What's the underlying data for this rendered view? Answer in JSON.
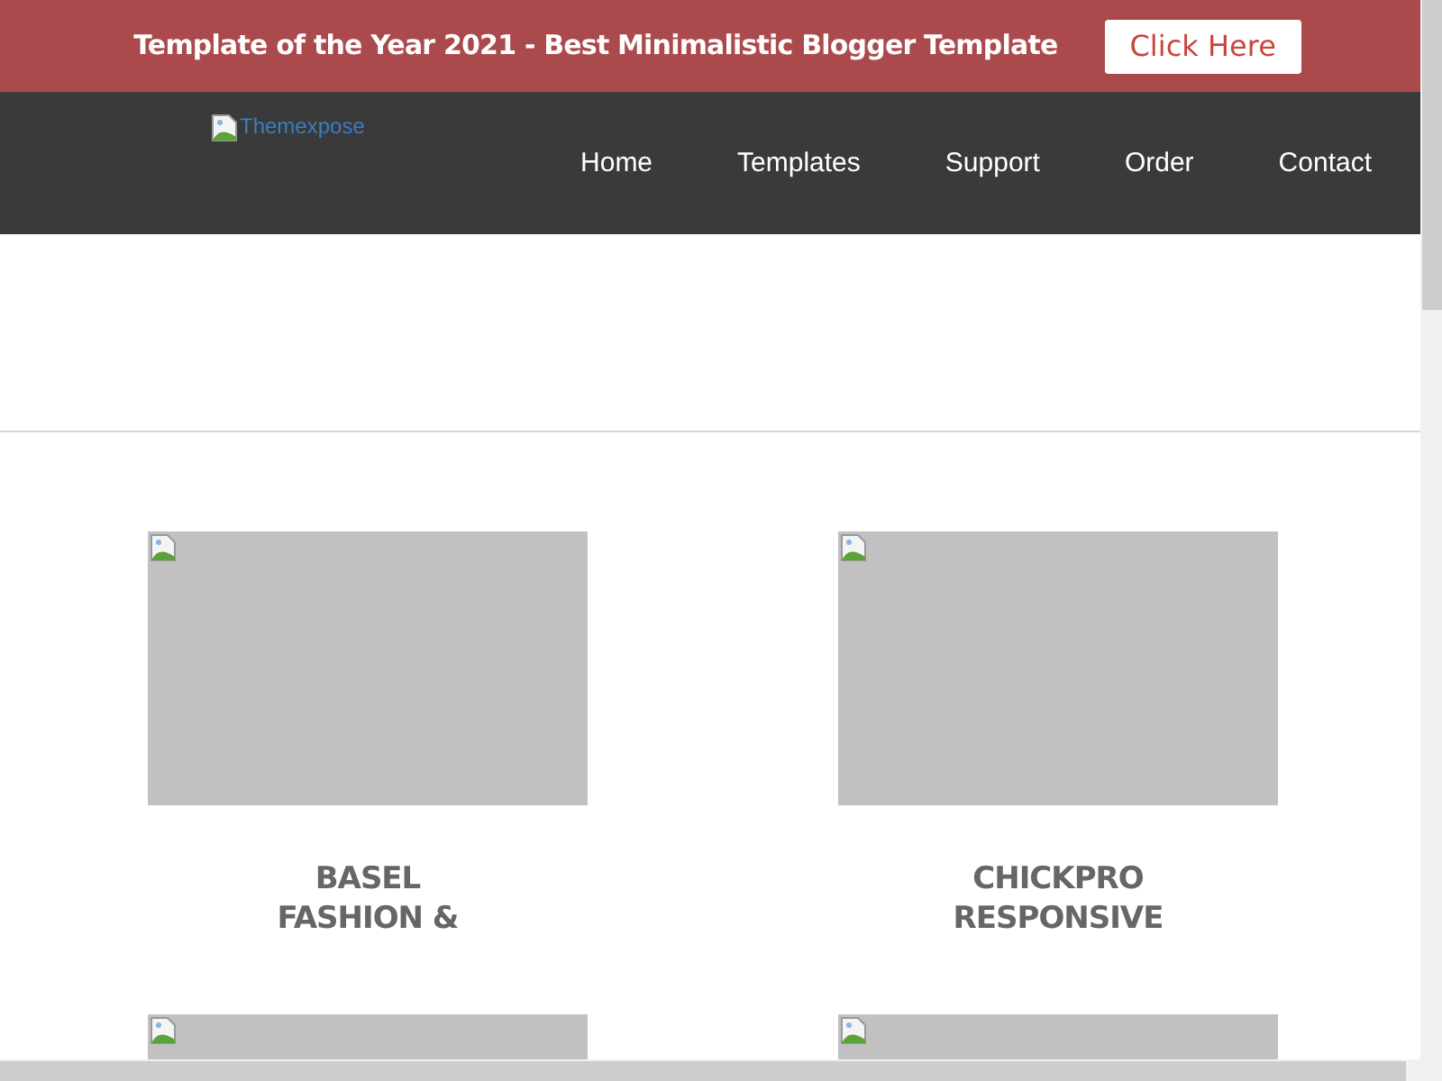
{
  "promo_bar": {
    "text": "Template of the Year 2021 - Best Minimalistic Blogger Template",
    "button": "Click Here"
  },
  "header": {
    "logo_alt": "Themexpose",
    "nav": [
      "Home",
      "Templates",
      "Support",
      "Order",
      "Contact"
    ]
  },
  "templates": [
    {
      "kind": "titled",
      "title_lines": [
        "BASEL",
        "FASHION &"
      ]
    },
    {
      "kind": "titled",
      "title_lines": [
        "CHICKPRO",
        "RESPONSIVE"
      ]
    },
    {
      "kind": "picture"
    },
    {
      "kind": "picture"
    }
  ]
}
